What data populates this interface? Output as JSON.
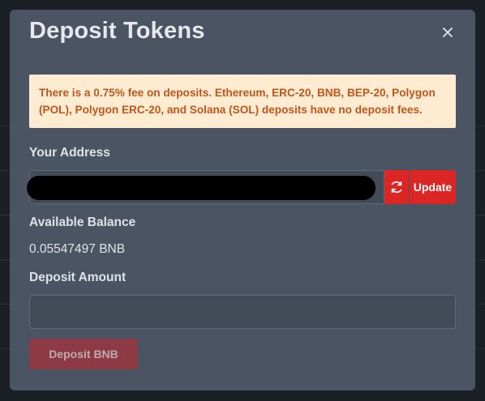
{
  "modal": {
    "title": "Deposit Tokens",
    "close_icon": "close-icon"
  },
  "alert": {
    "text": "There is a 0.75% fee on deposits. Ethereum, ERC-20, BNB, BEP-20, Polygon (POL), Polygon ERC-20, and Solana (SOL) deposits have no deposit fees."
  },
  "address": {
    "label": "Your Address",
    "value": "",
    "redacted": true,
    "refresh_icon": "refresh-icon",
    "update_label": "Update"
  },
  "balance": {
    "label": "Available Balance",
    "value": "0.05547497 BNB"
  },
  "deposit": {
    "label": "Deposit Amount",
    "value": "",
    "placeholder": "",
    "button_label": "Deposit BNB",
    "button_disabled": true
  },
  "colors": {
    "modal_bg": "#4a5462",
    "alert_bg": "#feecd2",
    "alert_text": "#c0561a",
    "accent_red": "#dc2626",
    "disabled_button": "#8d3a44"
  }
}
